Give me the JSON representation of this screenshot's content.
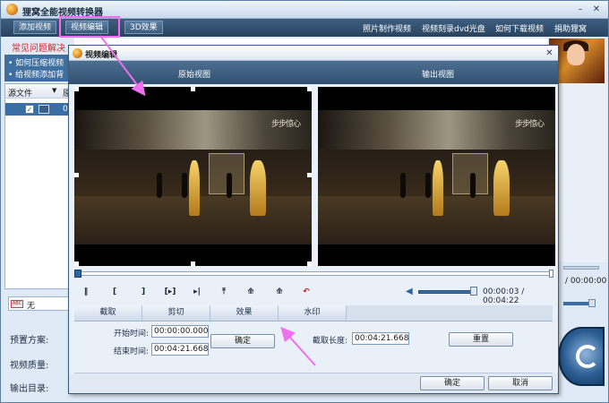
{
  "app": {
    "title": "狸窝全能视频转换器",
    "minimize": "–",
    "close": "✕",
    "tabs": [
      "添加视频",
      "视频编辑",
      "3D效果"
    ],
    "links": [
      "照片制作视频",
      "视频刻录dvd光盘",
      "如何下载视频",
      "捐助狸窝"
    ]
  },
  "faq": {
    "title": "常见问题解决",
    "items": [
      "• 如何压缩视频",
      "• 给视频添加背"
    ]
  },
  "banner": {
    "items": [
      "...",
      "..."
    ]
  },
  "file_list": {
    "header": "源文件",
    "col2": "原",
    "row_num": "0",
    "checked": "✓"
  },
  "subtitle": {
    "icon_text": "ABC",
    "value": "无"
  },
  "settings": {
    "preset_label": "预置方案:",
    "quality_label": "视频质量:",
    "output_label": "输出目录:"
  },
  "right_peek": {
    "time": "/ 00:00:00"
  },
  "dialog": {
    "title": "视频编辑",
    "close": "✕",
    "view_original": "原始视图",
    "view_output": "输出视图",
    "video_caption": "步步惊心",
    "controls": [
      "‖",
      "[",
      "]",
      "[▸]",
      "▸|",
      "⤒",
      "⟰",
      "⟰",
      "↶"
    ],
    "time": "00:00:03 / 00:04:22",
    "volume_level": 0.85,
    "tabs": [
      "截取",
      "剪切",
      "效果",
      "水印"
    ],
    "active_tab": "截取",
    "start_label": "开始时间:",
    "start_value": "00:00:00.000",
    "end_label": "结束时间:",
    "end_value": "00:04:21.668",
    "confirm_mid": "确定",
    "length_label": "截取长度:",
    "length_value": "00:04:21.668",
    "reset": "重置",
    "ok": "确定",
    "cancel": "取消"
  },
  "colors": {
    "toolbar": "#28435f",
    "active_tab": "#2e5479",
    "annotation": "#ef6fef",
    "faq_title": "#d42a2a"
  }
}
